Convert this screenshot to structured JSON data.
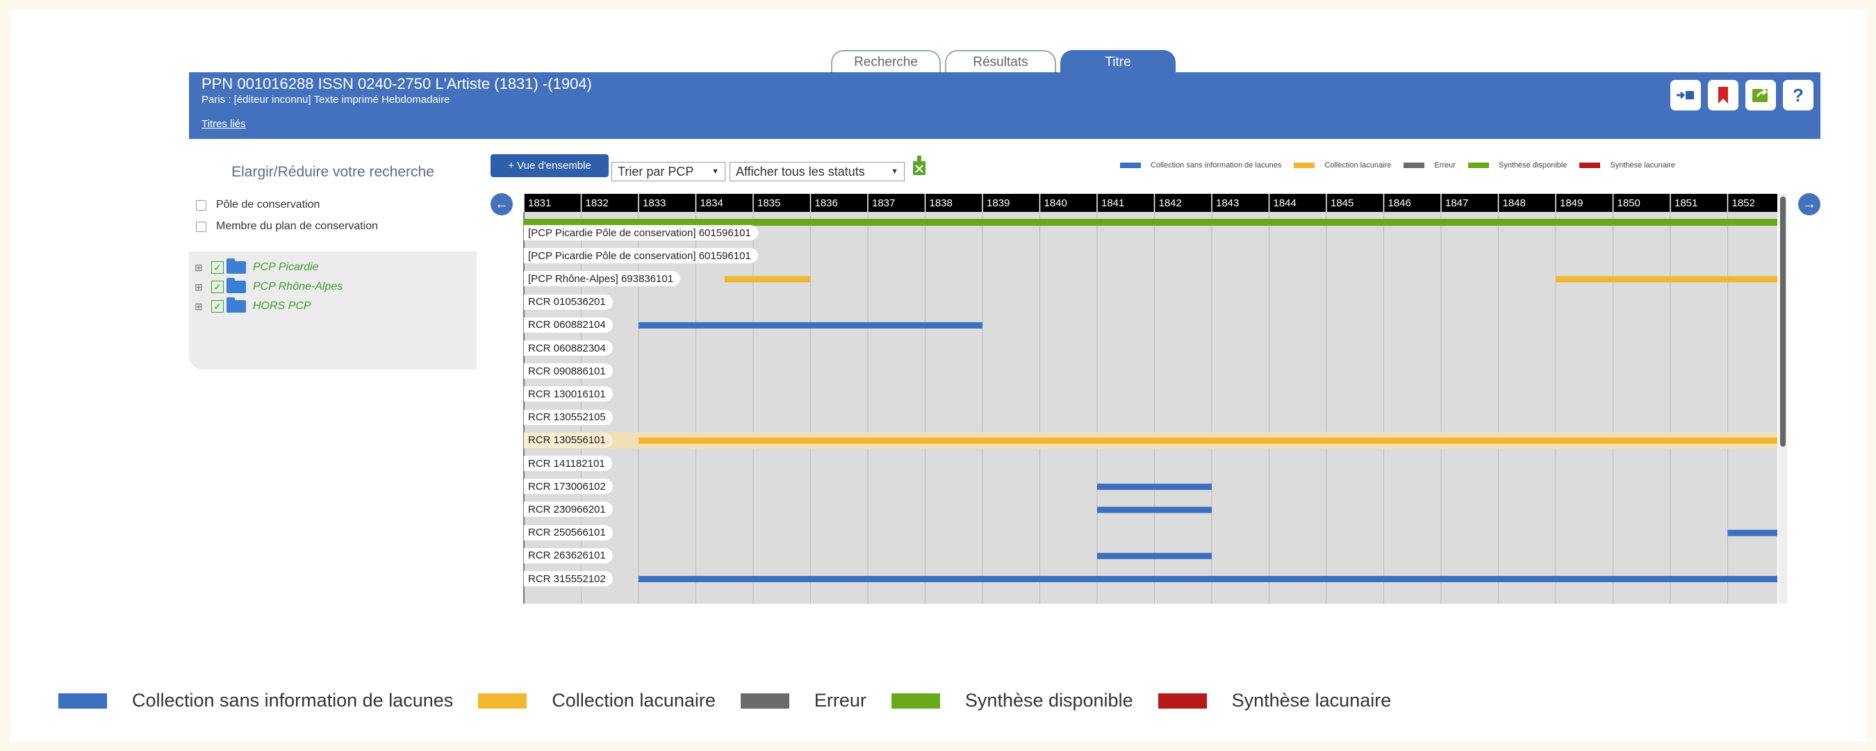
{
  "tabs": [
    {
      "label": "Recherche"
    },
    {
      "label": "Résultats"
    },
    {
      "label": "Titre"
    }
  ],
  "header": {
    "title": "PPN 001016288 ISSN 0240-2750   L'Artiste (1831) -(1904)",
    "subtitle": "Paris : [éditeur inconnu] Texte imprimé Hebdomadaire",
    "link": "Titres liés",
    "buttons": [
      "export-icon",
      "bookmark-icon",
      "share-icon",
      "help-icon"
    ],
    "help_label": "?"
  },
  "left_panel": {
    "heading": "Elargir/Réduire votre recherche",
    "checkboxes": [
      {
        "label": "Pôle de conservation"
      },
      {
        "label": "Membre du plan de conservation"
      }
    ],
    "tree": [
      {
        "label": "PCP Picardie"
      },
      {
        "label": "PCP Rhône-Alpes"
      },
      {
        "label": "HORS PCP"
      }
    ]
  },
  "controls": {
    "overview_button": "+ Vue d'ensemble",
    "sort_select": "Trier par PCP",
    "status_select": "Afficher tous les statuts"
  },
  "colors": {
    "blue": "#3b6fbf",
    "yellow": "#f0b72f",
    "gray": "#6b6b6b",
    "green": "#6aaa1a",
    "red": "#b81a1a"
  },
  "legend": [
    {
      "label": "Collection sans information de lacunes",
      "color": "#3b6fbf"
    },
    {
      "label": "Collection lacunaire",
      "color": "#f0b72f"
    },
    {
      "label": "Erreur",
      "color": "#6b6b6b"
    },
    {
      "label": "Synthèse disponible",
      "color": "#6aaa1a"
    },
    {
      "label": "Synthèse lacunaire",
      "color": "#b81a1a"
    }
  ],
  "timeline": {
    "years": [
      "1831",
      "1832",
      "1833",
      "1834",
      "1835",
      "1836",
      "1837",
      "1838",
      "1839",
      "1840",
      "1841",
      "1842",
      "1843",
      "1844",
      "1845",
      "1846",
      "1847",
      "1848",
      "1849",
      "1850",
      "1851",
      "1852"
    ],
    "synthesis": {
      "start": 1831,
      "end": 1853,
      "status": "green"
    },
    "rows": [
      {
        "label": "[PCP Picardie Pôle de conservation] 601596101",
        "bars": []
      },
      {
        "label": "[PCP Picardie Pôle de conservation] 601596101",
        "bars": []
      },
      {
        "label": "[PCP Rhône-Alpes] 693836101",
        "bars": [
          {
            "start": 1834.5,
            "end": 1836,
            "status": "yellow"
          },
          {
            "start": 1849,
            "end": 1853,
            "status": "yellow"
          }
        ]
      },
      {
        "label": "RCR 010536201",
        "bars": []
      },
      {
        "label": "RCR 060882104",
        "bars": [
          {
            "start": 1833,
            "end": 1839,
            "status": "blue"
          }
        ]
      },
      {
        "label": "RCR 060882304",
        "bars": []
      },
      {
        "label": "RCR 090886101",
        "bars": []
      },
      {
        "label": "RCR 130016101",
        "bars": []
      },
      {
        "label": "RCR 130552105",
        "bars": []
      },
      {
        "label": "RCR 130556101",
        "bars": [
          {
            "start": 1833,
            "end": 1853,
            "status": "yellow"
          }
        ],
        "highlight": true
      },
      {
        "label": "RCR 141182101",
        "bars": []
      },
      {
        "label": "RCR 173006102",
        "bars": [
          {
            "start": 1841,
            "end": 1843,
            "status": "blue"
          }
        ]
      },
      {
        "label": "RCR 230966201",
        "bars": [
          {
            "start": 1841,
            "end": 1843,
            "status": "blue"
          }
        ]
      },
      {
        "label": "RCR 250566101",
        "bars": [
          {
            "start": 1852,
            "end": 1853,
            "status": "blue"
          }
        ]
      },
      {
        "label": "RCR 263626101",
        "bars": [
          {
            "start": 1841,
            "end": 1843,
            "status": "blue"
          }
        ]
      },
      {
        "label": "RCR 315552102",
        "bars": [
          {
            "start": 1833,
            "end": 1853,
            "status": "blue"
          }
        ]
      }
    ]
  }
}
